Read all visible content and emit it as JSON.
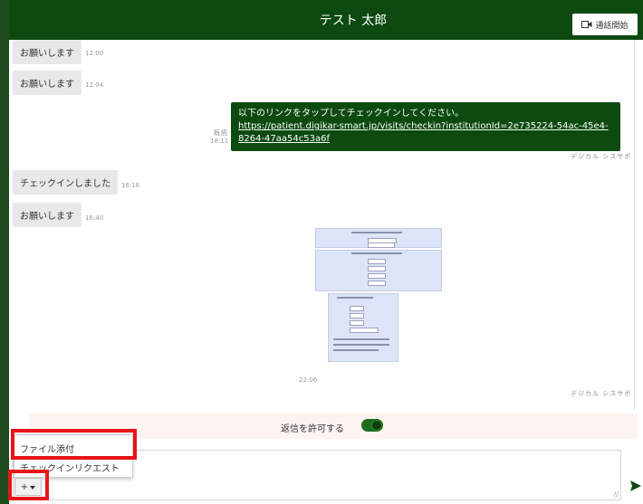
{
  "header": {
    "title": "テスト 太郎",
    "call_button_label": "通話開始",
    "close_label": "×"
  },
  "messages": [
    {
      "text": "お願いします",
      "time": "12:00"
    },
    {
      "text": "お願いします",
      "time": "12:04"
    },
    {
      "line1": "以下のリンクをタップしてチェックインしてください。",
      "link": "https://patient.digikar-smart.jp/visits/checkin?institutionId=2e735224-54ac-45e4-8264-47aa54c53a6f",
      "read": "既読",
      "time": "16:11",
      "sender": "デジカル シスサポ"
    },
    {
      "text": "チェックインしました",
      "time": "16:16"
    },
    {
      "text": "お願いします",
      "time": "16:40"
    },
    {
      "image": true,
      "time": "22:06",
      "sender": "デジカル シスサポ"
    }
  ],
  "reply_bar": {
    "label": "返信を許可する",
    "toggle_on": true,
    "toggle_color": "#1e6b1e"
  },
  "menu": {
    "items": [
      "ファイル添付",
      "チェックインリクエスト"
    ],
    "plus_label": "+"
  },
  "input": {
    "placeholder": ""
  },
  "colors": {
    "brand": "#0c4a10",
    "highlight": "#e8141a",
    "bubble_left": "#e8e8e8"
  },
  "icons": [
    "video-camera-icon",
    "close-icon",
    "chevron-down-icon",
    "send-icon",
    "resize-grip-icon"
  ]
}
